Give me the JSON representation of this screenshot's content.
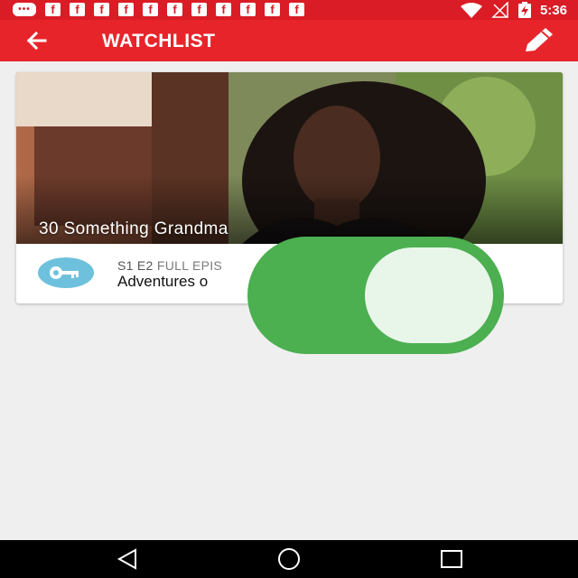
{
  "status_bar": {
    "time": "5:36",
    "notification_icons": [
      "message-icon",
      "facebook-icon",
      "facebook-icon",
      "facebook-icon",
      "facebook-icon",
      "facebook-icon",
      "facebook-icon",
      "facebook-icon",
      "facebook-icon",
      "facebook-icon",
      "facebook-icon",
      "facebook-icon"
    ],
    "right_icons": [
      "wifi-icon",
      "no-signal-icon",
      "battery-charging-icon"
    ]
  },
  "app_bar": {
    "title": "WATCHLIST",
    "back_icon": "back-arrow-icon",
    "edit_icon": "pencil-icon"
  },
  "watchlist": {
    "items": [
      {
        "show_title": "30 Something Grandma",
        "episode_code": "S1 E2",
        "episode_type": "FULL EPIS",
        "episode_name": "Adventures o",
        "badge_icon": "key-icon"
      }
    ]
  },
  "toggle": {
    "state": "on"
  },
  "colors": {
    "status_bar": "#d91c25",
    "app_bar": "#e8242b",
    "toggle_track": "#4caf50",
    "toggle_knob": "#e8f5e9",
    "key_badge": "#6ec1dc"
  },
  "nav_bar": {
    "buttons": [
      "back-icon",
      "home-icon",
      "recents-icon"
    ]
  }
}
